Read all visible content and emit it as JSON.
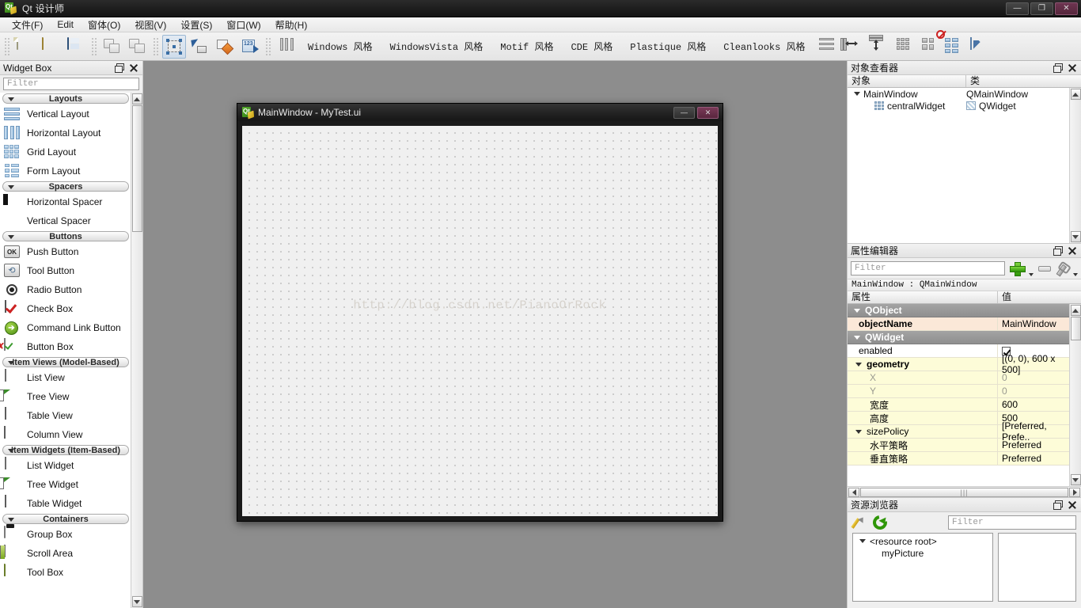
{
  "window": {
    "title": "Qt 设计师",
    "icon": "qt-logo-icon",
    "buttons": {
      "minimize": "—",
      "restore": "❐",
      "close": "✕"
    }
  },
  "menubar": {
    "items": [
      {
        "label": "文件(F)",
        "name": "menu-file"
      },
      {
        "label": "Edit",
        "name": "menu-edit"
      },
      {
        "label": "窗体(O)",
        "name": "menu-form"
      },
      {
        "label": "视图(V)",
        "name": "menu-view"
      },
      {
        "label": "设置(S)",
        "name": "menu-settings"
      },
      {
        "label": "窗口(W)",
        "name": "menu-window"
      },
      {
        "label": "帮助(H)",
        "name": "menu-help"
      }
    ]
  },
  "toolbar": {
    "file_group": [
      {
        "name": "new-form-button",
        "icon": "new-document-icon"
      },
      {
        "name": "open-form-button",
        "icon": "open-folder-icon"
      },
      {
        "name": "save-form-button",
        "icon": "floppy-disk-icon"
      }
    ],
    "edit_group": [
      {
        "name": "undo-button",
        "icon": "copy-squares-icon"
      },
      {
        "name": "redo-button",
        "icon": "copy-squares-icon"
      }
    ],
    "mode_group": [
      {
        "name": "edit-widgets-button",
        "icon": "edit-widgets-icon",
        "active": true
      },
      {
        "name": "edit-signals-slots-button",
        "icon": "signals-slots-icon",
        "active": false
      },
      {
        "name": "edit-buddies-button",
        "icon": "buddy-tag-icon",
        "active": false
      },
      {
        "name": "edit-tab-order-button",
        "icon": "tab-order-123-icon",
        "active": false
      }
    ],
    "styles": [
      {
        "label": "Windows 风格",
        "name": "style-windows"
      },
      {
        "label": "WindowsVista 风格",
        "name": "style-windowsvista"
      },
      {
        "label": "Motif 风格",
        "name": "style-motif"
      },
      {
        "label": "CDE 风格",
        "name": "style-cde"
      },
      {
        "label": "Plastique 风格",
        "name": "style-plastique"
      },
      {
        "label": "Cleanlooks 风格",
        "name": "style-cleanlooks"
      }
    ],
    "layout_group": [
      {
        "name": "layout-vertical-button",
        "icon": "layout-vertical-icon"
      },
      {
        "name": "layout-horizontal-splitter-button",
        "icon": "split-horizontal-icon"
      },
      {
        "name": "layout-vertical-splitter-button",
        "icon": "split-vertical-icon"
      },
      {
        "name": "layout-grid-button",
        "icon": "layout-grid-icon"
      },
      {
        "name": "layout-form-button",
        "icon": "layout-form-icon"
      },
      {
        "name": "break-layout-button",
        "icon": "break-layout-icon"
      },
      {
        "name": "adjust-size-button",
        "icon": "adjust-size-icon"
      }
    ]
  },
  "widget_box": {
    "title": "Widget Box",
    "filter_placeholder": "Filter",
    "categories": [
      {
        "label": "Layouts",
        "name": "category-layouts",
        "items": [
          {
            "label": "Vertical Layout",
            "icon": "vertical-layout-icon"
          },
          {
            "label": "Horizontal Layout",
            "icon": "horizontal-layout-icon"
          },
          {
            "label": "Grid Layout",
            "icon": "grid-layout-icon"
          },
          {
            "label": "Form Layout",
            "icon": "form-layout-icon"
          }
        ]
      },
      {
        "label": "Spacers",
        "name": "category-spacers",
        "items": [
          {
            "label": "Horizontal Spacer",
            "icon": "horizontal-spacer-icon"
          },
          {
            "label": "Vertical Spacer",
            "icon": "vertical-spacer-icon"
          }
        ]
      },
      {
        "label": "Buttons",
        "name": "category-buttons",
        "items": [
          {
            "label": "Push Button",
            "icon": "push-button-icon"
          },
          {
            "label": "Tool Button",
            "icon": "tool-button-icon"
          },
          {
            "label": "Radio Button",
            "icon": "radio-button-icon"
          },
          {
            "label": "Check Box",
            "icon": "check-box-icon"
          },
          {
            "label": "Command Link Button",
            "icon": "command-link-icon"
          },
          {
            "label": "Button Box",
            "icon": "button-box-icon"
          }
        ]
      },
      {
        "label": "Item Views (Model-Based)",
        "name": "category-item-views",
        "items": [
          {
            "label": "List View",
            "icon": "list-view-icon"
          },
          {
            "label": "Tree View",
            "icon": "tree-view-icon"
          },
          {
            "label": "Table View",
            "icon": "table-view-icon"
          },
          {
            "label": "Column View",
            "icon": "column-view-icon"
          }
        ]
      },
      {
        "label": "Item Widgets (Item-Based)",
        "name": "category-item-widgets",
        "items": [
          {
            "label": "List Widget",
            "icon": "list-widget-icon"
          },
          {
            "label": "Tree Widget",
            "icon": "tree-widget-icon"
          },
          {
            "label": "Table Widget",
            "icon": "table-widget-icon"
          }
        ]
      },
      {
        "label": "Containers",
        "name": "category-containers",
        "items": [
          {
            "label": "Group Box",
            "icon": "group-box-icon"
          },
          {
            "label": "Scroll Area",
            "icon": "scroll-area-icon"
          },
          {
            "label": "Tool Box",
            "icon": "tool-box-icon"
          }
        ]
      }
    ]
  },
  "form_window": {
    "title": "MainWindow - MyTest.ui",
    "icon": "qt-logo-icon",
    "buttons": {
      "minimize": "—",
      "close": "✕"
    },
    "watermark": "http://blog.csdn.net/PianoOrRock"
  },
  "object_inspector": {
    "title": "对象查看器",
    "columns": [
      "对象",
      "类"
    ],
    "rows": [
      {
        "object": "MainWindow",
        "class": "QMainWindow",
        "level": 0,
        "icon": "expand-triangle-icon"
      },
      {
        "object": "centralWidget",
        "class": "QWidget",
        "level": 1,
        "icon": "grid-widget-icon"
      }
    ]
  },
  "property_editor": {
    "title": "属性编辑器",
    "filter_placeholder": "Filter",
    "object_line": "MainWindow : QMainWindow",
    "columns": [
      "属性",
      "值"
    ],
    "rows": [
      {
        "name": "QObject",
        "value": "",
        "style": "group",
        "expandable": true
      },
      {
        "name": "objectName",
        "value": "MainWindow",
        "style": "peach",
        "expandable": false
      },
      {
        "name": "QWidget",
        "value": "",
        "style": "group",
        "expandable": true
      },
      {
        "name": "enabled",
        "value": "",
        "style": "white",
        "expandable": false,
        "checkbox": true
      },
      {
        "name": "geometry",
        "value": "[(0, 0), 600 x 500]",
        "style": "yellow",
        "expandable": true,
        "bold": true
      },
      {
        "name": "X",
        "value": "0",
        "style": "yellow",
        "sub": true,
        "dim": true
      },
      {
        "name": "Y",
        "value": "0",
        "style": "yellow",
        "sub": true,
        "dim": true
      },
      {
        "name": "宽度",
        "value": "600",
        "style": "yellow",
        "sub": true
      },
      {
        "name": "高度",
        "value": "500",
        "style": "yellow",
        "sub": true
      },
      {
        "name": "sizePolicy",
        "value": "[Preferred, Prefe..",
        "style": "yellow",
        "expandable": true
      },
      {
        "name": "水平策略",
        "value": "Preferred",
        "style": "yellow",
        "sub": true
      },
      {
        "name": "垂直策略",
        "value": "Preferred",
        "style": "yellow",
        "sub": true
      }
    ]
  },
  "resource_browser": {
    "title": "资源浏览器",
    "filter_placeholder": "Filter",
    "edit_icon": "pencil-edit-icon",
    "reload_icon": "refresh-icon",
    "tree": [
      {
        "label": "<resource root>",
        "level": 0,
        "icon": "expand-triangle-icon"
      },
      {
        "label": "myPicture",
        "level": 1,
        "icon": ""
      }
    ]
  },
  "colors": {
    "titlebar": "#1d1d1d",
    "canvas_bg": "#8d8d8d",
    "panel_bg": "#efefef",
    "property_group": "#999999",
    "property_peach": "#fbe8d8",
    "property_yellow": "#fdfcd8",
    "accent_green": "#2f9608",
    "close_button": "#6d3550"
  }
}
